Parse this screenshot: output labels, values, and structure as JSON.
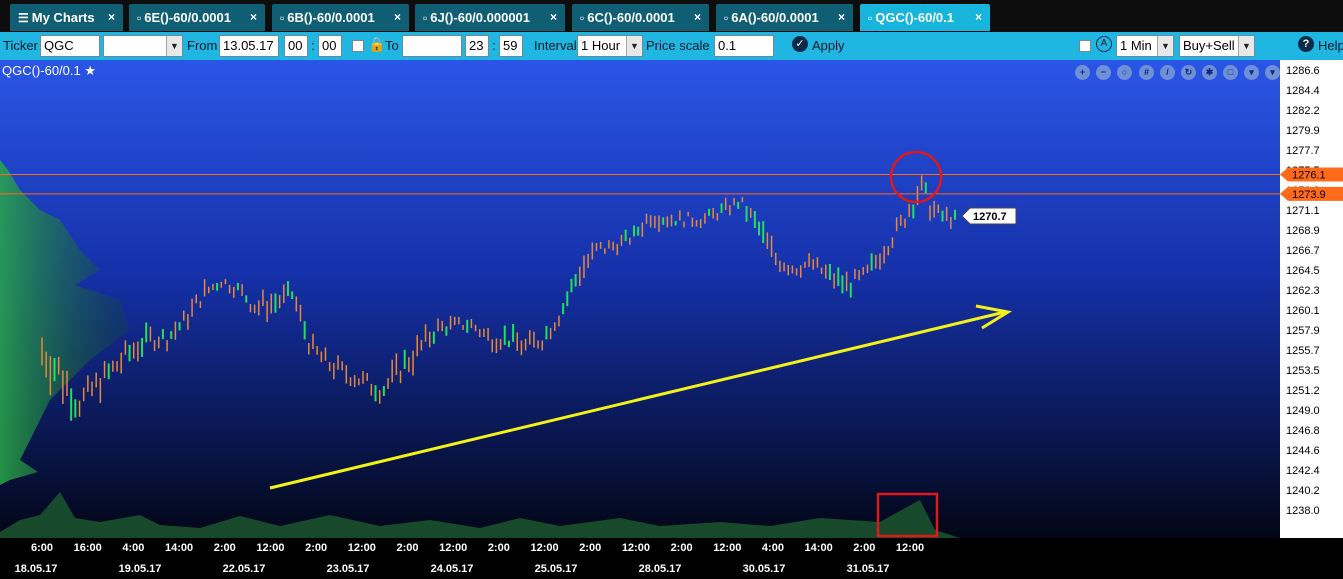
{
  "tabs": [
    {
      "label": "My Charts",
      "icon": "list-icon",
      "active": false
    },
    {
      "label": "6E()-60/0.0001",
      "icon": "bar-chart-icon",
      "active": false
    },
    {
      "label": "6B()-60/0.0001",
      "icon": "bar-chart-icon",
      "active": false
    },
    {
      "label": "6J()-60/0.000001",
      "icon": "bar-chart-icon",
      "active": false
    },
    {
      "label": "6C()-60/0.0001",
      "icon": "bar-chart-icon",
      "active": false
    },
    {
      "label": "6A()-60/0.0001",
      "icon": "bar-chart-icon",
      "active": false
    },
    {
      "label": "QGC()-60/0.1",
      "icon": "bar-chart-icon",
      "active": true
    }
  ],
  "toolbar": {
    "ticker_label": "Ticker",
    "ticker_value": "QGC",
    "from_label": "From",
    "from_date": "13.05.17",
    "from_hour": "00",
    "from_minute": "00",
    "to_label": "To",
    "to_date": "",
    "to_hour": "23",
    "to_minute": "59",
    "interval_label": "Interval",
    "interval_value": "1 Hour",
    "price_scale_label": "Price scale",
    "price_scale_value": "0.1",
    "apply_label": "Apply",
    "timeframe_value": "1 Min",
    "side_value": "Buy+Sell",
    "help_label": "Help"
  },
  "chart": {
    "title": "QGC()-60/0.1",
    "tool_icons": [
      "zoom-in-icon",
      "zoom-out-icon",
      "zoom-reset-icon",
      "grid-icon",
      "draw-icon",
      "refresh-icon",
      "settings-icon",
      "fullscreen-icon",
      "down-icon"
    ],
    "colors": {
      "up_bar": "#22e05a",
      "down_bar": "#e8883a",
      "level_line": "#ff6a1a",
      "arrow": "#f2f21a",
      "highlight": "#e01818",
      "profile": "#1f8a3a"
    }
  },
  "chart_data": {
    "type": "bar",
    "symbol": "QGC()-60/0.1",
    "y_ticks": [
      "1286.6",
      "1284.4",
      "1282.2",
      "1279.9",
      "1277.7",
      "1275.5",
      "1273.3",
      "1271.1",
      "1268.9",
      "1266.7",
      "1264.5",
      "1262.3",
      "1260.1",
      "1257.9",
      "1255.7",
      "1253.5",
      "1251.2",
      "1249.0",
      "1246.8",
      "1244.6",
      "1242.4",
      "1240.2",
      "1238.0"
    ],
    "ylim": [
      1237,
      1288
    ],
    "levels": [
      {
        "label": "1276.1",
        "value": 1276.1
      },
      {
        "label": "1273.9",
        "value": 1273.9
      }
    ],
    "last_price": "1270.7",
    "x_time_labels": [
      "6:00",
      "16:00",
      "4:00",
      "14:00",
      "2:00",
      "12:00",
      "2:00",
      "12:00",
      "2:00",
      "12:00",
      "2:00",
      "12:00",
      "2:00",
      "12:00",
      "2:00",
      "12:00",
      "4:00",
      "14:00",
      "2:00",
      "12:00"
    ],
    "x_date_labels": [
      "18.05.17",
      "19.05.17",
      "22.05.17",
      "23.05.17",
      "24.05.17",
      "25.05.17",
      "28.05.17",
      "30.05.17",
      "31.05.17"
    ],
    "price_path": [
      [
        1253,
        1259
      ],
      [
        1250,
        1257
      ],
      [
        1248,
        1252
      ],
      [
        1250,
        1254
      ],
      [
        1252,
        1256
      ],
      [
        1254,
        1258
      ],
      [
        1256,
        1259
      ],
      [
        1256,
        1259
      ],
      [
        1258,
        1261
      ],
      [
        1261,
        1264
      ],
      [
        1263,
        1265
      ],
      [
        1262,
        1264
      ],
      [
        1259,
        1263
      ],
      [
        1260,
        1263
      ],
      [
        1261,
        1264
      ],
      [
        1255,
        1258
      ],
      [
        1253,
        1256
      ],
      [
        1252,
        1255
      ],
      [
        1251,
        1254
      ],
      [
        1250,
        1253
      ],
      [
        1252,
        1256
      ],
      [
        1254,
        1258
      ],
      [
        1257,
        1260
      ],
      [
        1258,
        1260
      ],
      [
        1258,
        1260
      ],
      [
        1256,
        1259
      ],
      [
        1256,
        1259
      ],
      [
        1255,
        1258
      ],
      [
        1256,
        1259
      ],
      [
        1259,
        1262
      ],
      [
        1263,
        1267
      ],
      [
        1266,
        1269
      ],
      [
        1267,
        1269
      ],
      [
        1268,
        1270
      ],
      [
        1270,
        1273
      ],
      [
        1270,
        1272
      ],
      [
        1270,
        1272
      ],
      [
        1270,
        1272
      ],
      [
        1271,
        1273
      ],
      [
        1272,
        1274
      ],
      [
        1268,
        1272
      ],
      [
        1265,
        1268
      ],
      [
        1264,
        1267
      ],
      [
        1265,
        1267
      ],
      [
        1263,
        1266
      ],
      [
        1262,
        1265
      ],
      [
        1263,
        1266
      ],
      [
        1266,
        1269
      ],
      [
        1269,
        1272
      ],
      [
        1272,
        1277
      ],
      [
        1270,
        1273
      ],
      [
        1270,
        1272
      ]
    ]
  }
}
